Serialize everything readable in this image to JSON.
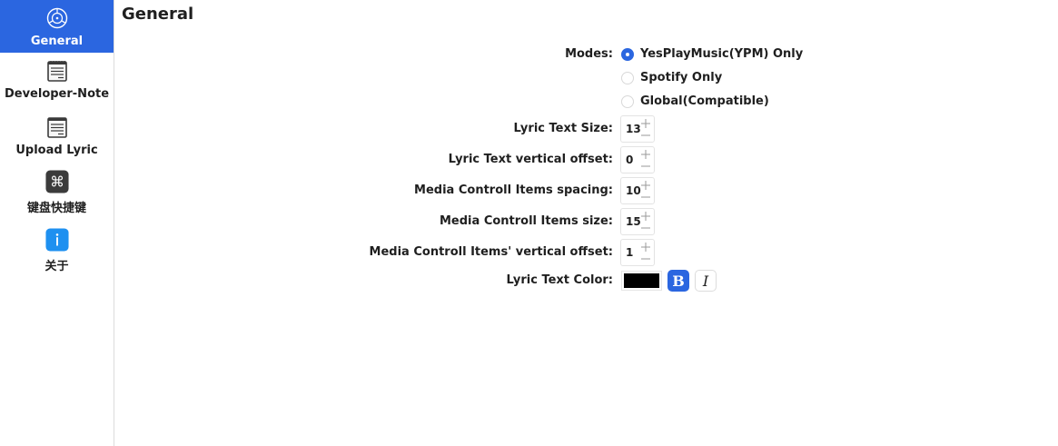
{
  "sidebar": {
    "items": [
      {
        "label": "General",
        "icon": "gear-icon",
        "active": true
      },
      {
        "label": "Developer-Note",
        "icon": "notepad-icon",
        "active": false
      },
      {
        "label": "Upload Lyric",
        "icon": "notepad-icon",
        "active": false
      },
      {
        "label": "键盘快捷键",
        "icon": "command-key-icon",
        "active": false
      },
      {
        "label": "关于",
        "icon": "info-icon",
        "active": false
      }
    ]
  },
  "main": {
    "title": "General",
    "modes": {
      "label": "Modes:",
      "options": [
        {
          "label": "YesPlayMusic(YPM) Only",
          "selected": true
        },
        {
          "label": "Spotify Only",
          "selected": false
        },
        {
          "label": "Global(Compatible)",
          "selected": false
        }
      ]
    },
    "steppers": [
      {
        "label": "Lyric Text Size:",
        "value": "13"
      },
      {
        "label": "Lyric Text vertical offset:",
        "value": "0"
      },
      {
        "label": "Media Controll Items spacing:",
        "value": "10"
      },
      {
        "label": "Media Controll Items size:",
        "value": "15"
      },
      {
        "label": "Media Controll Items' vertical offset:",
        "value": "1"
      }
    ],
    "color": {
      "label": "Lyric Text Color:",
      "value": "#000000",
      "bold_glyph": "B",
      "italic_glyph": "I"
    }
  },
  "colors": {
    "accent": "#2b66e0",
    "text": "#1f1f1f",
    "border": "#dcdcdc"
  }
}
